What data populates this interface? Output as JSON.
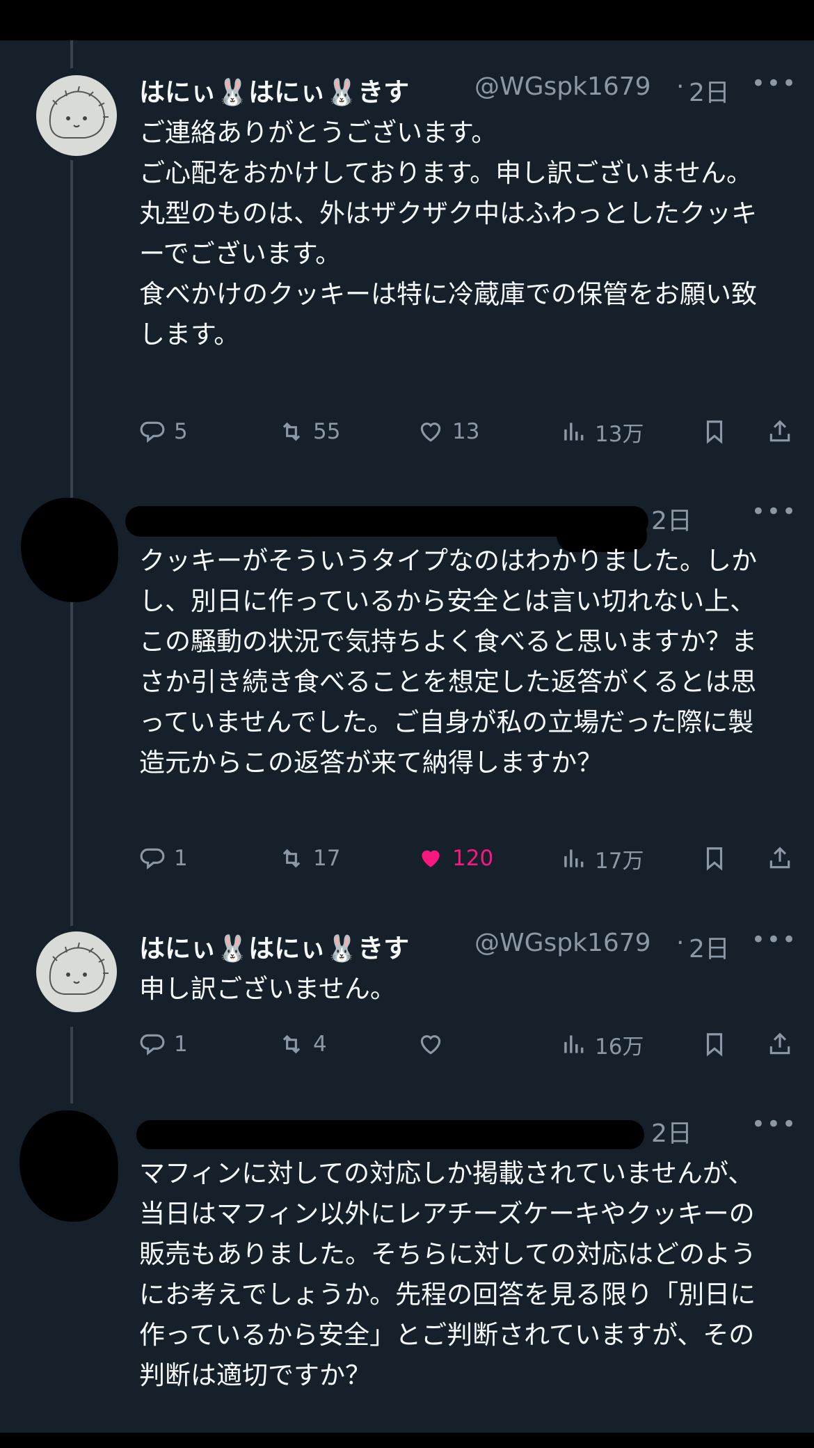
{
  "tweets": [
    {
      "author_name": "はにぃ🐰はにぃ🐰きす",
      "handle": "@WGspk1679",
      "time": "2日",
      "more": "•••",
      "text": "ご連絡ありがとうございます。\nご心配をおかけしております。申し訳ございません。\n丸型のものは、外はザクザク中はふわっとしたクッキーでございます。\n食べかけのクッキーは特に冷蔵庫での保管をお願い致します。",
      "replies": "5",
      "retweets": "55",
      "likes": "13",
      "views": "13万",
      "liked": false
    },
    {
      "author_name": "",
      "handle": "",
      "time": "2日",
      "more": "•••",
      "text": "クッキーがそういうタイプなのはわかりました。しかし、別日に作っているから安全とは言い切れない上、この騒動の状況で気持ちよく食べると思いますか？まさか引き続き食べることを想定した返答がくるとは思っていませんでした。ご自身が私の立場だった際に製造元からこの返答が来て納得しますか？",
      "replies": "1",
      "retweets": "17",
      "likes": "120",
      "views": "17万",
      "liked": true
    },
    {
      "author_name": "はにぃ🐰はにぃ🐰きす",
      "handle": "@WGspk1679",
      "time": "2日",
      "more": "•••",
      "text": "申し訳ございません。",
      "replies": "1",
      "retweets": "4",
      "likes": "",
      "views": "16万",
      "liked": false
    },
    {
      "author_name": "",
      "handle": "",
      "time": "2日",
      "more": "•••",
      "text": "マフィンに対しての対応しか掲載されていませんが、当日はマフィン以外にレアチーズケーキやクッキーの販売もありました。そちらに対しての対応はどのようにお考えでしょうか。先程の回答を見る限り「別日に作っているから安全」とご判断されていますが、その判断は適切ですか？",
      "replies": "",
      "retweets": "",
      "likes": "",
      "views": "",
      "liked": false
    }
  ],
  "colors": {
    "background": "#15202b",
    "text": "#f7f9f9",
    "muted": "#8b98a5",
    "like_active": "#f91880",
    "thread_line": "#38444d"
  },
  "icons": [
    "reply-icon",
    "retweet-icon",
    "like-icon",
    "views-icon",
    "bookmark-icon",
    "share-icon",
    "more-icon"
  ]
}
